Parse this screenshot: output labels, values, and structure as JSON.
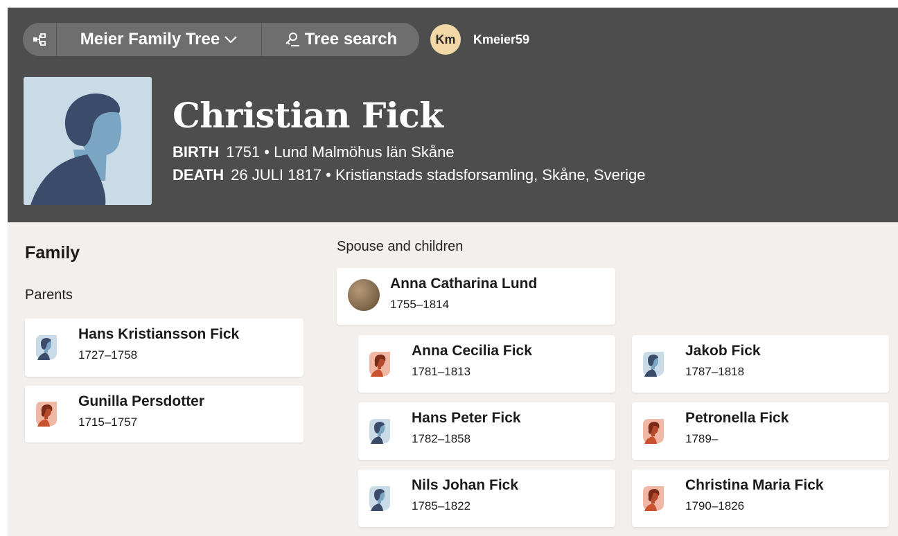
{
  "nav": {
    "tree_name": "Meier Family Tree",
    "search_label": "Tree search",
    "user_initials": "Km",
    "username": "Kmeier59"
  },
  "person": {
    "name": "Christian Fick",
    "birth_label": "BIRTH",
    "birth_value": "1751 • Lund Malmöhus län Skåne",
    "death_label": "DEATH",
    "death_value": "26 JULI 1817 • Kristianstads stadsforsamling, Skåne, Sverige"
  },
  "family": {
    "title": "Family",
    "parents_label": "Parents",
    "parents": [
      {
        "name": "Hans Kristiansson Fick",
        "dates": "1727–1758",
        "gender": "male"
      },
      {
        "name": "Gunilla Persdotter",
        "dates": "1715–1757",
        "gender": "female"
      }
    ],
    "spouse_label": "Spouse and children",
    "spouse": {
      "name": "Anna Catharina Lund",
      "dates": "1755–1814"
    },
    "children": [
      {
        "name": "Anna Cecilia Fick",
        "dates": "1781–1813",
        "gender": "female"
      },
      {
        "name": "Jakob Fick",
        "dates": "1787–1818",
        "gender": "male"
      },
      {
        "name": "Hans Peter Fick",
        "dates": "1782–1858",
        "gender": "male"
      },
      {
        "name": "Petronella Fick",
        "dates": "1789–",
        "gender": "female"
      },
      {
        "name": "Nils Johan Fick",
        "dates": "1785–1822",
        "gender": "male"
      },
      {
        "name": "Christina Maria Fick",
        "dates": "1790–1826",
        "gender": "female"
      }
    ]
  },
  "colors": {
    "header_bg": "#4d4d4d",
    "body_bg": "#f2efec",
    "male_avatar": "#c8dbe7",
    "female_avatar": "#f0b8a4"
  }
}
